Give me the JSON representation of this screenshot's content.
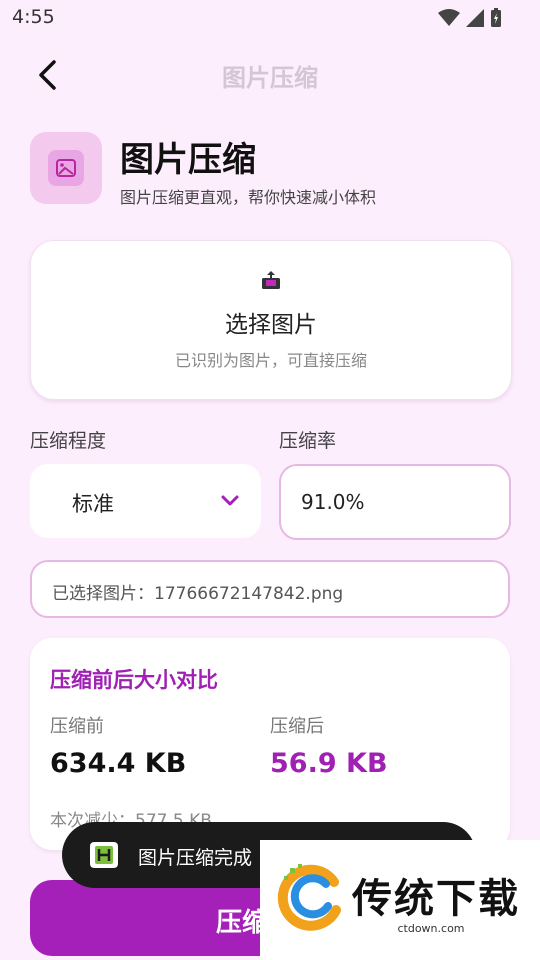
{
  "status_bar": {
    "time": "4:55"
  },
  "header": {
    "title": "图片压缩"
  },
  "hero": {
    "title": "图片压缩",
    "subtitle": "图片压缩更直观，帮你快速减小体积"
  },
  "picker": {
    "label": "选择图片",
    "hint": "已识别为图片，可直接压缩"
  },
  "level": {
    "label": "压缩程度",
    "value": "标准"
  },
  "rate": {
    "label": "压缩率",
    "value": "91.0%"
  },
  "file": {
    "text": "已选择图片：17766672147842.png"
  },
  "compare": {
    "title": "压缩前后大小对比",
    "before_label": "压缩前",
    "before_value": "634.4 KB",
    "after_label": "压缩后",
    "after_value": "56.9 KB",
    "reduced": "本次减少：577.5 KB"
  },
  "toast": {
    "text": "图片压缩完成"
  },
  "action": {
    "label": "压缩"
  },
  "watermark": {
    "brand": "传统下载",
    "url": "ctdown.com"
  },
  "colors": {
    "accent": "#a51fb9",
    "background": "#fdeefd",
    "toast": "#1b1b1b"
  }
}
